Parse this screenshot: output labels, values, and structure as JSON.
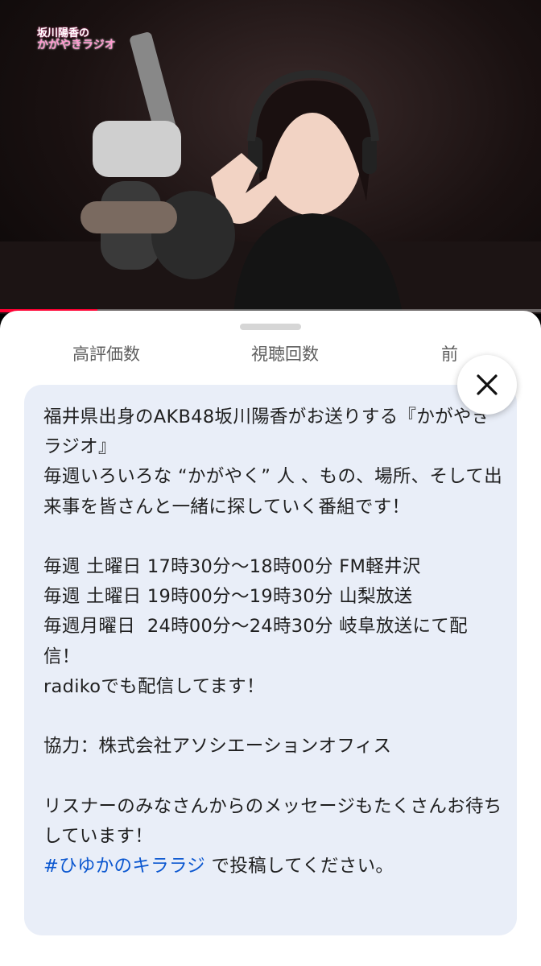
{
  "video": {
    "logo_line1": "坂川陽香の",
    "logo_line2": "かがやきラジオ",
    "progress_percent": 18
  },
  "stats": {
    "likes_label": "高評価数",
    "views_label": "視聴回数",
    "date_label": "前"
  },
  "description": {
    "line1": "福井県出身のAKB48坂川陽香がお送りする『かがやきラジオ』",
    "line2": "毎週いろいろな “かがやく” 人 、もの、場所、そして出来事を皆さんと一緒に探していく番組です！",
    "schedule1": "毎週 土曜日 17時30分〜18時00分 FM軽井沢",
    "schedule2": "毎週 土曜日 19時00分〜19時30分 山梨放送",
    "schedule3": "毎週月曜日  24時00分〜24時30分 岐阜放送にて配信！",
    "radiko": "radikoでも配信してます！",
    "cooperation": "協力：株式会社アソシエーションオフィス",
    "message": "リスナーのみなさんからのメッセージもたくさんお待ちしています！",
    "hashtag": "#ひゆかのキララジ",
    "hashtag_suffix": " で投稿してください。"
  },
  "icons": {
    "close": "close-icon"
  },
  "colors": {
    "progress": "#ff0033",
    "hashtag": "#0b57d0",
    "desc_bg": "#e9eef8"
  }
}
